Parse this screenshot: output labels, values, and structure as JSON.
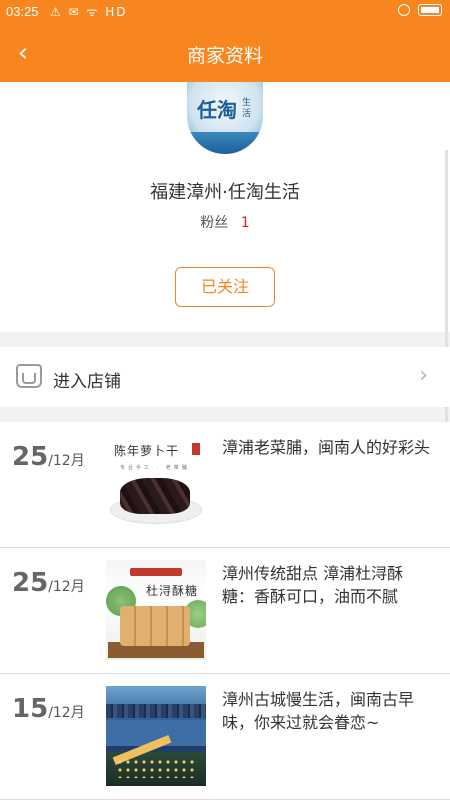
{
  "status_bar": {
    "time": "03:25",
    "icons": "⚠ ✉ ᯤ HD"
  },
  "header": {
    "back_glyph": "‹",
    "title": "商家资料"
  },
  "profile": {
    "avatar_text": "任淘",
    "avatar_sub": "生活",
    "name": "福建漳州·任淘生活",
    "fans_label": "粉丝",
    "fans_count": "1",
    "follow_label": "已关注"
  },
  "store_link": {
    "label": "进入店铺",
    "chevron": "›",
    "icon": "store-icon"
  },
  "posts": [
    {
      "day": "25",
      "month": "/12月",
      "title": "漳浦老菜脯，闽南人的好彩头",
      "thumb_text": "陈年萝卜干",
      "thumb_sub": "专业手工 · 老菜脯"
    },
    {
      "day": "25",
      "month": "/12月",
      "title": "漳州传统甜点 漳浦杜浔酥糖：香酥可口，油而不腻",
      "thumb_text": "杜浔酥糖"
    },
    {
      "day": "15",
      "month": "/12月",
      "title": "漳州古城慢生活，闽南古早味，你来过就会眷恋~"
    }
  ],
  "colors": {
    "accent": "#f7861e",
    "fans_count": "#e02020"
  }
}
